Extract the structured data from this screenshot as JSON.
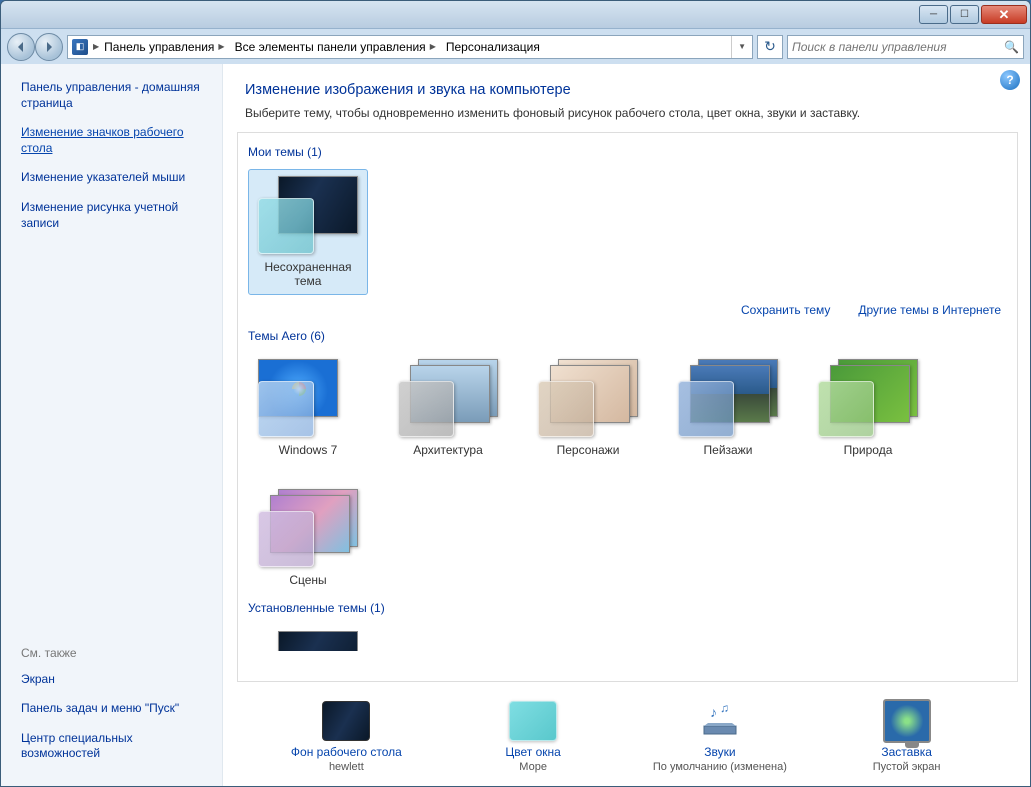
{
  "breadcrumb": {
    "seg1": "Панель управления",
    "seg2": "Все элементы панели управления",
    "seg3": "Персонализация"
  },
  "search": {
    "placeholder": "Поиск в панели управления"
  },
  "sidebar": {
    "home": "Панель управления - домашняя страница",
    "links": [
      "Изменение значков рабочего стола",
      "Изменение указателей мыши",
      "Изменение рисунка учетной записи"
    ],
    "also_title": "См. также",
    "also": [
      "Экран",
      "Панель задач и меню \"Пуск\"",
      "Центр специальных возможностей"
    ]
  },
  "page": {
    "title": "Изменение изображения и звука на компьютере",
    "subtitle": "Выберите тему, чтобы одновременно изменить фоновый рисунок рабочего стола, цвет окна, звуки и заставку."
  },
  "groups": {
    "my": {
      "title": "Мои темы (1)",
      "items": [
        "Несохраненная тема"
      ]
    },
    "aero": {
      "title": "Темы Aero (6)",
      "items": [
        "Windows 7",
        "Архитектура",
        "Персонажи",
        "Пейзажи",
        "Природа",
        "Сцены"
      ]
    },
    "installed": {
      "title": "Установленные темы (1)"
    }
  },
  "group_links": {
    "save": "Сохранить тему",
    "more": "Другие темы в Интернете"
  },
  "bottom": {
    "items": [
      {
        "label": "Фон рабочего стола",
        "sub": "hewlett"
      },
      {
        "label": "Цвет окна",
        "sub": "Море"
      },
      {
        "label": "Звуки",
        "sub": "По умолчанию (изменена)"
      },
      {
        "label": "Заставка",
        "sub": "Пустой экран"
      }
    ]
  }
}
